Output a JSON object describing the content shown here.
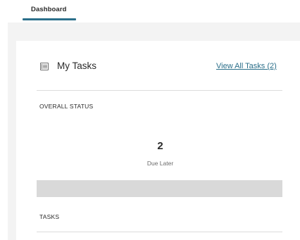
{
  "tabs": [
    {
      "label": "Dashboard",
      "active": true
    }
  ],
  "card": {
    "title": "My Tasks",
    "icon": "task-list-icon",
    "view_all_label": "View All Tasks (2)"
  },
  "overall_status": {
    "label": "OVERALL STATUS",
    "count": "2",
    "caption": "Due Later",
    "bar_fill_fraction": 1.0,
    "bar_color": "#d9d9d9"
  },
  "tasks_section": {
    "label": "TASKS"
  },
  "colors": {
    "accent": "#2b6f8a",
    "page_background": "#f3f3f3"
  }
}
